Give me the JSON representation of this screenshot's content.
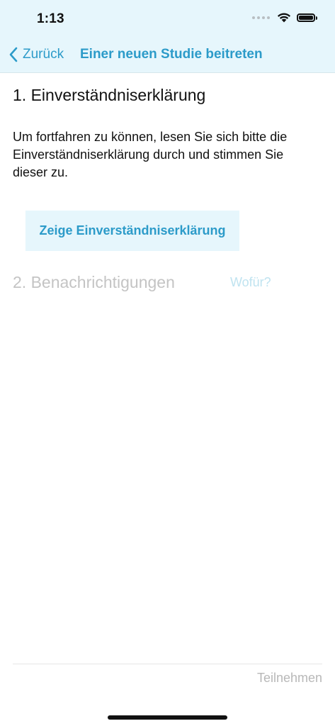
{
  "status_bar": {
    "time": "1:13",
    "icons": [
      "cellular-signal-icon",
      "wifi-icon",
      "battery-icon"
    ]
  },
  "nav": {
    "back_label": "Zurück",
    "title": "Einer neuen Studie beitreten"
  },
  "steps": [
    {
      "heading": "1. Einverständniserklärung",
      "description": "Um fortfahren zu können, lesen Sie sich bitte die Einverständniserklärung durch und stimmen Sie dieser zu.",
      "button_label": "Zeige Einverständniserklärung"
    },
    {
      "heading": "2. Benachrichtigungen",
      "help_link": "Wofür?"
    }
  ],
  "footer": {
    "join_label": "Teilnehmen"
  },
  "colors": {
    "accent": "#2C9BC9",
    "header_background": "#E6F6FC",
    "disabled_text": "#C4C4C4"
  }
}
